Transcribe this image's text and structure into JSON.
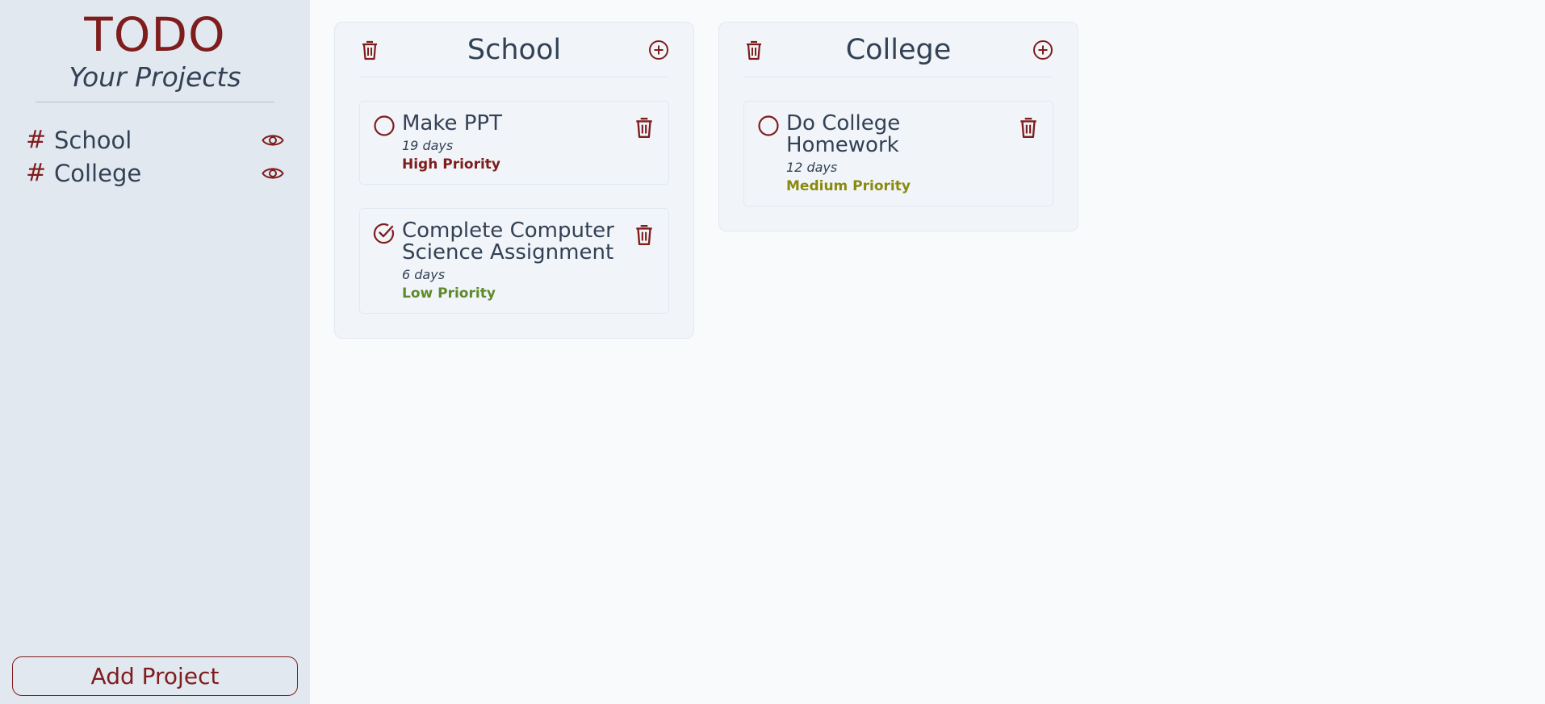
{
  "sidebar": {
    "brand": "TODO",
    "subtitle": "Your Projects",
    "projects": [
      {
        "hash": "#",
        "name": "School"
      },
      {
        "hash": "#",
        "name": "College"
      }
    ],
    "add_project_label": "Add Project"
  },
  "projects": [
    {
      "title": "School",
      "tasks": [
        {
          "title": "Make PPT",
          "days": "19 days",
          "priority": "High Priority",
          "done": false
        },
        {
          "title": "Complete Computer Science Assignment",
          "days": "6 days",
          "priority": "Low Priority",
          "done": true
        }
      ]
    },
    {
      "title": "College",
      "tasks": [
        {
          "title": "Do College Homework",
          "days": "12 days",
          "priority": "Medium Priority",
          "done": false
        }
      ]
    }
  ],
  "colors": {
    "accent": "#7f1d1d",
    "high_priority": "#7f1d1d",
    "medium_priority": "#8a8a0f",
    "low_priority": "#5f8a2a",
    "sidebar_bg": "#e2e8f0",
    "main_bg": "#f8fafc"
  },
  "icons": {
    "trash": "trash-icon",
    "add": "plus-circle-icon",
    "eye": "eye-icon",
    "circle": "circle-icon",
    "check": "check-circle-icon"
  }
}
